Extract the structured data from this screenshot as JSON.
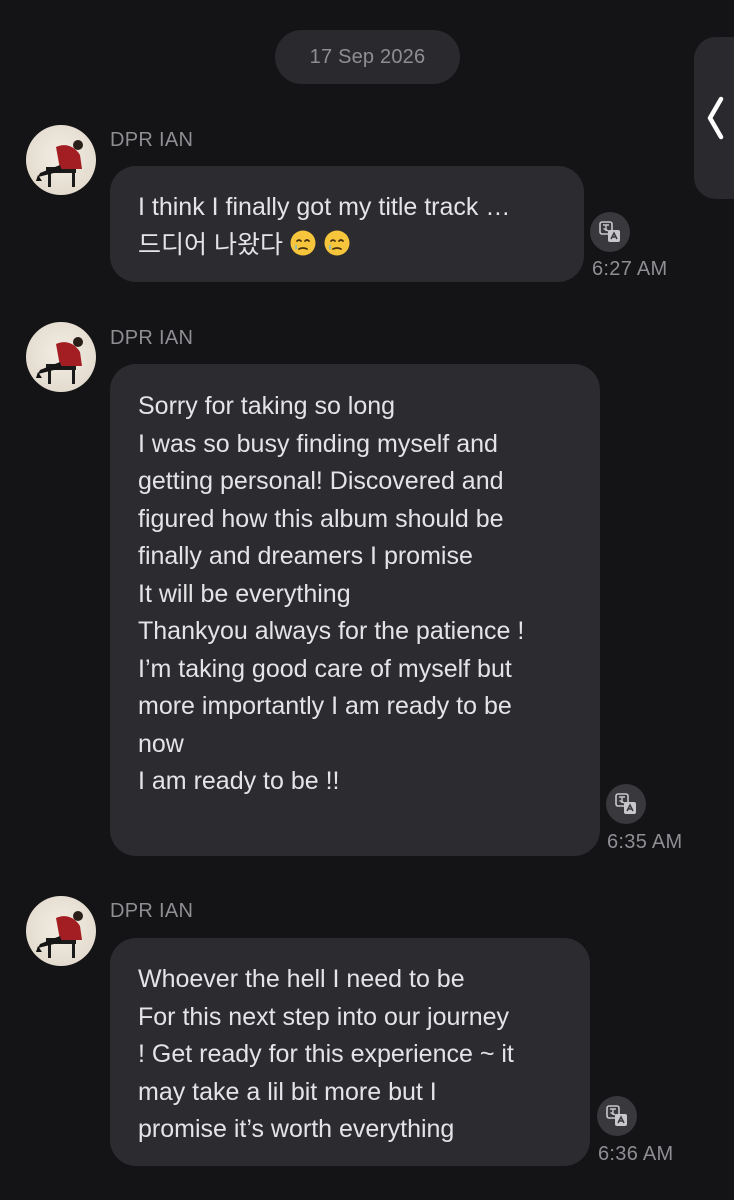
{
  "chat": {
    "date_separator": "17 Sep 2026",
    "messages": [
      {
        "sender": "DPR IAN",
        "lines": [
          "I think I finally got my title track …",
          "드디어 나왔다"
        ],
        "time": "6:27 AM"
      },
      {
        "sender": "DPR IAN",
        "lines": [
          "Sorry for taking so long",
          "I was so busy finding myself and",
          "getting personal! Discovered and",
          "figured how this album should be",
          "finally and dreamers I promise",
          "It will be everything",
          "Thankyou always for the patience !",
          "I’m taking good care of myself but",
          "more importantly I am ready to be",
          "now",
          "I am ready to be !!"
        ],
        "time": "6:35 AM"
      },
      {
        "sender": "DPR IAN",
        "lines": [
          "Whoever the hell I need to be",
          "For this next step into our journey",
          "! Get ready for this experience ~ it",
          "may take a lil bit more but I",
          "promise it’s worth everything"
        ],
        "time": "6:36 AM"
      }
    ]
  },
  "icons": {
    "translate": "translate-icon",
    "collapse_handle": "chevron-left-icon",
    "crying_emoji": "smiling-face-with-tear-emoji"
  },
  "colors": {
    "background": "#141416",
    "bubble": "#2c2c30",
    "muted_text": "#8e8e93",
    "text": "#e4e4e7"
  }
}
